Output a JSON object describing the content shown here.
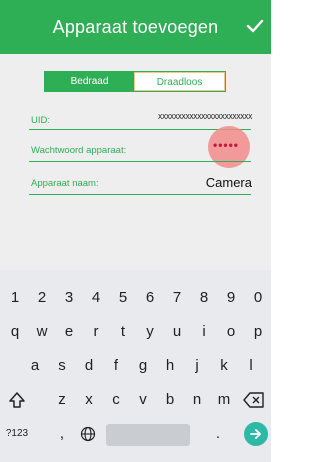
{
  "header": {
    "title": "Apparaat toevoegen",
    "background": "#2eae55"
  },
  "segment": {
    "wired_label": "Bedraad",
    "wireless_label": "Draadloos",
    "selected": "Bedraad"
  },
  "fields": {
    "uid_label": "UID:",
    "uid_value": "XXXXXXXXXXXXXXXXXXXXXXXX",
    "password_label": "Wachtwoord apparaat:",
    "password_value": "•••••",
    "name_label": "Apparaat naam:",
    "name_value": "Camera"
  },
  "keyboard": {
    "number_row": [
      "1",
      "2",
      "3",
      "4",
      "5",
      "6",
      "7",
      "8",
      "9",
      "0"
    ],
    "row1": [
      "q",
      "w",
      "e",
      "r",
      "t",
      "y",
      "u",
      "i",
      "o",
      "p"
    ],
    "row2": [
      "a",
      "s",
      "d",
      "f",
      "g",
      "h",
      "j",
      "k",
      "l"
    ],
    "row3": [
      "z",
      "x",
      "c",
      "v",
      "b",
      "n",
      "m"
    ],
    "symbols_label": "?123",
    "comma": ",",
    "period": "."
  }
}
